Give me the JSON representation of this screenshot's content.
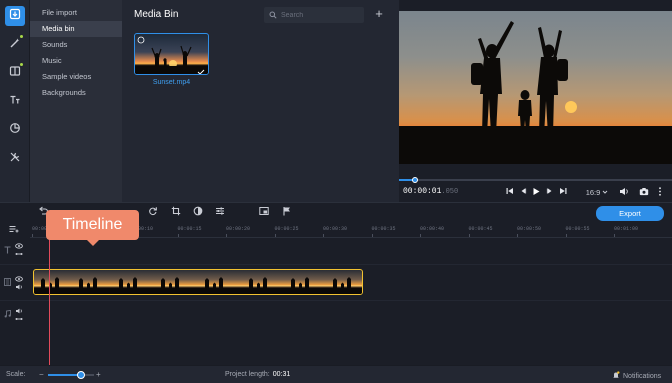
{
  "sidebar_tools": [
    {
      "icon": "import-icon",
      "active": true
    },
    {
      "icon": "magic-wand-icon",
      "active": false
    },
    {
      "icon": "filters-icon",
      "active": false
    },
    {
      "icon": "titles-icon",
      "active": false
    },
    {
      "icon": "stickers-icon",
      "active": false
    },
    {
      "icon": "tools-icon",
      "active": false
    }
  ],
  "categories": [
    "File import",
    "Media bin",
    "Sounds",
    "Music",
    "Sample videos",
    "Backgrounds"
  ],
  "active_category_index": 1,
  "bin": {
    "title": "Media Bin",
    "search_placeholder": "Search",
    "add_label": "+",
    "items": [
      {
        "name": "Sunset.mp4"
      }
    ]
  },
  "player": {
    "timecode": "00:00:01",
    "timecode_fraction": ".050",
    "progress": 0.06,
    "aspect_ratio": "16:9"
  },
  "toolbar": {
    "export_label": "Export"
  },
  "ruler_ticks": [
    "00:00:00",
    "00:00:05",
    "00:00:10",
    "00:00:15",
    "00:00:20",
    "00:00:25",
    "00:00:30",
    "00:00:35",
    "00:00:40",
    "00:00:45",
    "00:00:50",
    "00:00:55",
    "00:01:00"
  ],
  "callout": {
    "text": "Timeline"
  },
  "status": {
    "scale_label": "Scale:",
    "zoom_level": 0.72,
    "project_length_label": "Project length:",
    "project_length_value": "00:31",
    "notifications_label": "Notifications"
  },
  "colors": {
    "accent": "#2f8fe8",
    "clip_border": "#f2c230",
    "playhead": "#e24b5b",
    "callout": "#f0896b"
  }
}
